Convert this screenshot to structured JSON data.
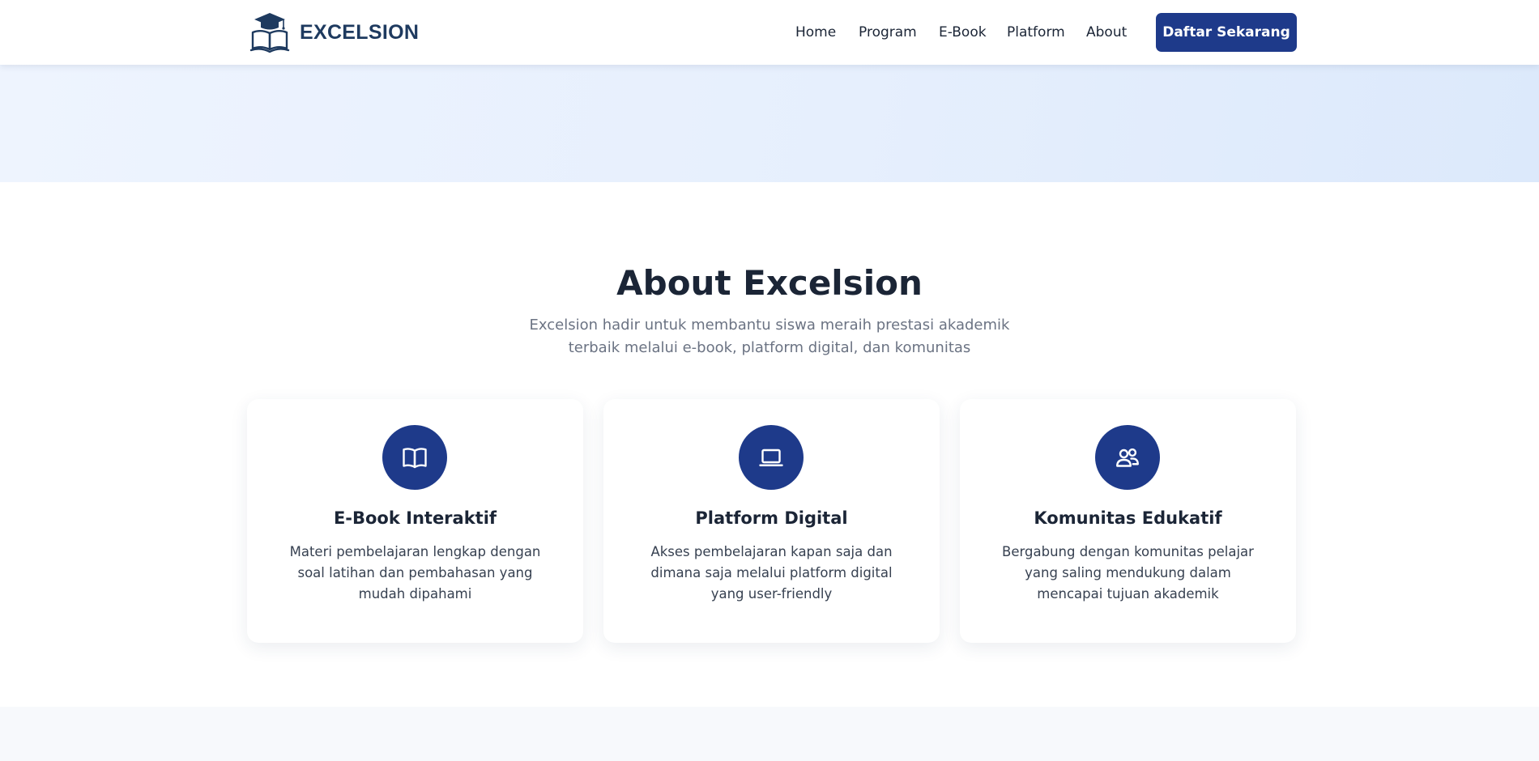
{
  "brand": {
    "name": "EXCELSION",
    "logo_icon": "graduation-book-logo"
  },
  "nav": {
    "links": [
      {
        "label": "Home"
      },
      {
        "label": "Program"
      },
      {
        "label": "E-Book"
      },
      {
        "label": "Platform"
      },
      {
        "label": "About"
      }
    ],
    "cta_label": "Daftar Sekarang"
  },
  "about": {
    "title": "About Excelsion",
    "subtitle": "Excelsion hadir untuk membantu siswa meraih prestasi akademik terbaik melalui e-book, platform digital, dan komunitas",
    "cards": [
      {
        "icon": "book-open-icon",
        "title": "E-Book Interaktif",
        "description": "Materi pembelajaran lengkap dengan soal latihan dan pembahasan yang mudah dipahami"
      },
      {
        "icon": "laptop-icon",
        "title": "Platform Digital",
        "description": "Akses pembelajaran kapan saja dan dimana saja melalui platform digital yang user-friendly"
      },
      {
        "icon": "users-icon",
        "title": "Komunitas Edukatif",
        "description": "Bergabung dengan komunitas pelajar yang saling mendukung dalam mencapai tujuan akademik"
      }
    ]
  },
  "colors": {
    "primary": "#1e3a8a",
    "brand_text": "#1e3a5f",
    "heading": "#1b2536",
    "muted_text": "#6b7383",
    "hero_band": "#e6effd"
  }
}
